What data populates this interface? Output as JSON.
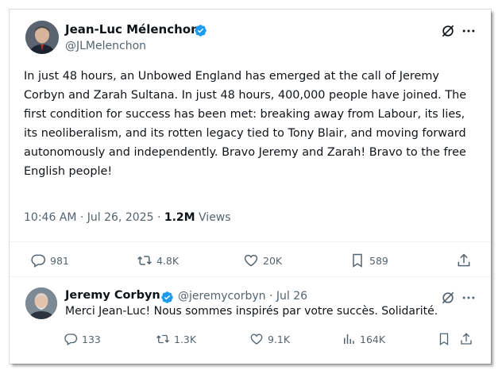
{
  "tweet": {
    "author_name": "Jean-Luc Mélenchon",
    "author_handle": "@JLMelenchon",
    "text": "In just 48 hours, an Unbowed England has emerged at the call of Jeremy Corbyn and Zarah Sultana. In just 48 hours, 400,000 people have joined. The first condition for success has been met: breaking away from Labour, its lies, its neoliberalism, and its rotten legacy tied to Tony Blair, and moving forward autonomously and independently. Bravo Jeremy and Zarah! Bravo to the free English people!",
    "time": "10:46 AM · Jul 26, 2025 ·",
    "views_count": "1.2M",
    "views_label": "Views",
    "replies": "981",
    "reposts": "4.8K",
    "likes": "20K",
    "bookmarks": "589"
  },
  "reply": {
    "author_name": "Jeremy Corbyn",
    "author_handle": "@jeremycorbyn · Jul 26",
    "text": "Merci Jean-Luc! Nous sommes inspirés par votre succès. Solidarité.",
    "replies": "133",
    "reposts": "1.3K",
    "likes": "9.1K",
    "views": "164K"
  },
  "icons": {
    "verified": "verified-badge-icon",
    "grok": "grok-icon",
    "more": "more-icon",
    "reply": "reply-icon",
    "repost": "repost-icon",
    "like": "like-icon",
    "bookmark": "bookmark-icon",
    "share": "share-icon",
    "views": "views-icon"
  },
  "colors": {
    "verified": "#1d9bf0",
    "text": "#0f1419",
    "muted": "#536471",
    "divider": "#eff3f4"
  }
}
